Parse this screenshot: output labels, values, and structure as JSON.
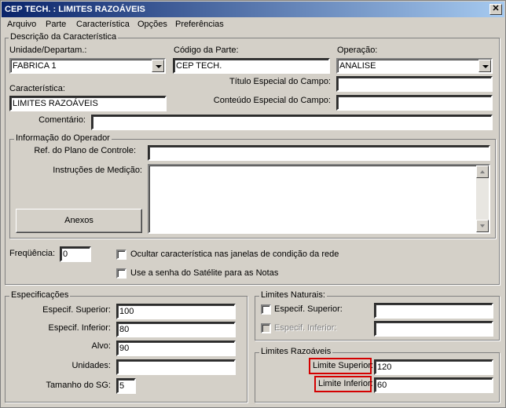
{
  "window": {
    "title": "CEP TECH. : LIMITES RAZOÁVEIS",
    "close_glyph": "✕"
  },
  "menu": [
    "Arquivo",
    "Parte",
    "Característica",
    "Opções",
    "Preferências"
  ],
  "descricao": {
    "legend": "Descrição da Característica",
    "unidade_label": "Unidade/Departam.:",
    "unidade_value": "FABRICA 1",
    "codigo_label": "Código da Parte:",
    "codigo_value": "CEP TECH.",
    "operacao_label": "Operação:",
    "operacao_value": "ANALISE",
    "titulo_label": "Título Especial do Campo:",
    "titulo_value": "",
    "caracteristica_label": "Característica:",
    "caracteristica_value": "LIMITES RAZOÁVEIS",
    "conteudo_label": "Conteúdo Especial do Campo:",
    "conteudo_value": "",
    "comentario_label": "Comentário:",
    "comentario_value": ""
  },
  "operador": {
    "legend": "Informação do Operador",
    "ref_label": "Ref. do Plano de Controle:",
    "ref_value": "",
    "instrucoes_label": "Instruções de Medição:",
    "instrucoes_value": "",
    "anexos_button": "Anexos"
  },
  "frequencia": {
    "label": "Freqüência:",
    "value": "0"
  },
  "options": {
    "ocultar_label": "Ocultar característica nas janelas de condição da rede",
    "ocultar_checked": false,
    "senha_label": "Use a senha do Satélite para as Notas",
    "senha_checked": false
  },
  "especificacoes": {
    "legend": "Especificações",
    "superior_label": "Especif. Superior:",
    "superior_value": "100",
    "inferior_label": "Especif. Inferior:",
    "inferior_value": "80",
    "alvo_label": "Alvo:",
    "alvo_value": "90",
    "unidades_label": "Unidades:",
    "unidades_value": "",
    "tamanho_label": "Tamanho do SG:",
    "tamanho_value": "5"
  },
  "naturais": {
    "legend": "Limites Naturais:",
    "superior_label": "Especif. Superior:",
    "superior_value": "",
    "inferior_label": "Especif. Inferior:",
    "inferior_value": ""
  },
  "razoaveis": {
    "legend": "Limites Razoáveis",
    "superior_label": "Limite Superior:",
    "superior_value": "120",
    "inferior_label": "Limite Inferior:",
    "inferior_value": "60",
    "highlight_color": "#d40000"
  }
}
